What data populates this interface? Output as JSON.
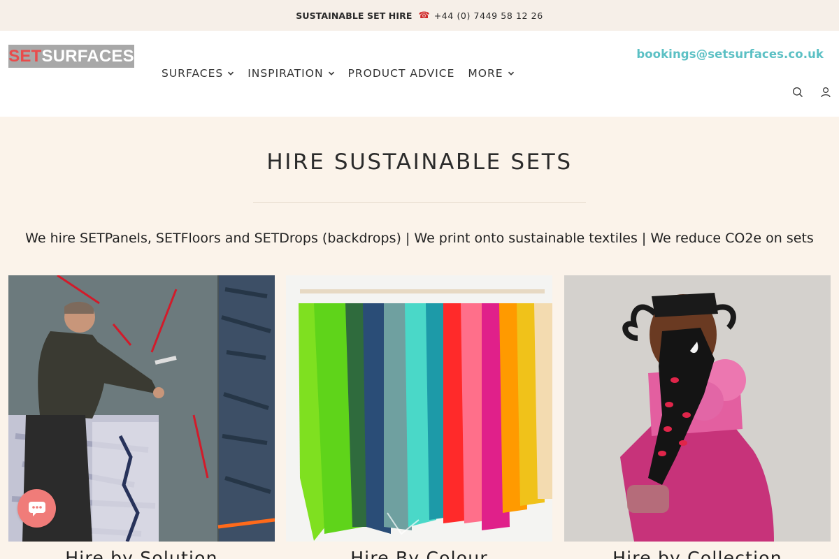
{
  "topbar": {
    "promo": "SUSTAINABLE SET HIRE",
    "phone_icon": "☎",
    "phone": "+44 (0) 7449 58 12 26"
  },
  "logo": {
    "part1": "SET",
    "part2": "SURFACES"
  },
  "nav": {
    "items": [
      {
        "label": "SURFACES",
        "has_dropdown": true
      },
      {
        "label": "INSPIRATION",
        "has_dropdown": true
      },
      {
        "label": "PRODUCT ADVICE",
        "has_dropdown": false
      },
      {
        "label": "MORE",
        "has_dropdown": true
      }
    ]
  },
  "header": {
    "email": "bookings@setsurfaces.co.uk",
    "icons": [
      "search-icon",
      "account-icon"
    ]
  },
  "main": {
    "title": "HIRE SUSTAINABLE SETS",
    "subtitle": "We hire SETPanels, SETFloors and SETDrops (backdrops) | We print onto sustainable textiles | We reduce CO2e on sets",
    "cards": [
      {
        "label": "Hire by Solution"
      },
      {
        "label": "Hire By Colour"
      },
      {
        "label": "Hire by Collection"
      }
    ]
  },
  "colors": {
    "accent": "#5bc0c4",
    "brand_red": "#e94b4b",
    "background": "#fbf3ea",
    "chat": "#f07c79"
  },
  "chat": {
    "icon": "chat-icon"
  }
}
